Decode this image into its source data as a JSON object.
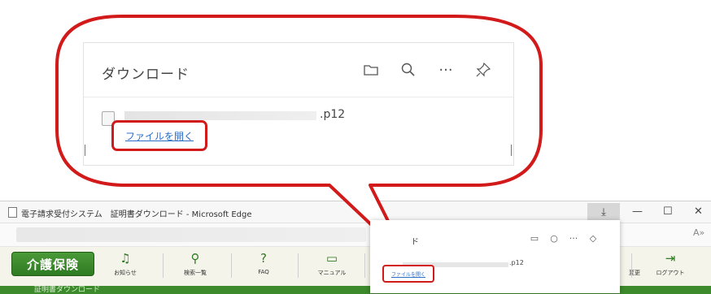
{
  "zoom": {
    "title": "ダウンロード",
    "icons": [
      "folder-icon",
      "search-icon",
      "more-icon",
      "pin-icon"
    ],
    "file_ext": ".p12",
    "open_file_label": "ファイルを開く"
  },
  "browser": {
    "window_title": "電子請求受付システム　証明書ダウンロード - Microsoft Edge",
    "service_button": "介護保険",
    "nav_items": [
      {
        "icon": "bell-icon",
        "label": "お知らせ"
      },
      {
        "icon": "search-icon",
        "label": "検索一覧"
      },
      {
        "icon": "faq-icon",
        "label": "FAQ"
      },
      {
        "icon": "book-icon",
        "label": "マニュアル"
      }
    ],
    "right_nav": [
      {
        "label": "変更"
      },
      {
        "icon": "logout-icon",
        "label": "ログアウト"
      }
    ],
    "subheader": "証明書ダウンロード",
    "controls": {
      "download": "⤓",
      "minimize": "—",
      "maximize": "☐",
      "close": "✕"
    }
  },
  "mini": {
    "title": "ド",
    "file_ext": ".p12",
    "open_file_label": "ファイルを開く"
  },
  "colors": {
    "highlight": "#d21a1a",
    "link": "#2b6fc9",
    "brand_green": "#2f7a22"
  }
}
